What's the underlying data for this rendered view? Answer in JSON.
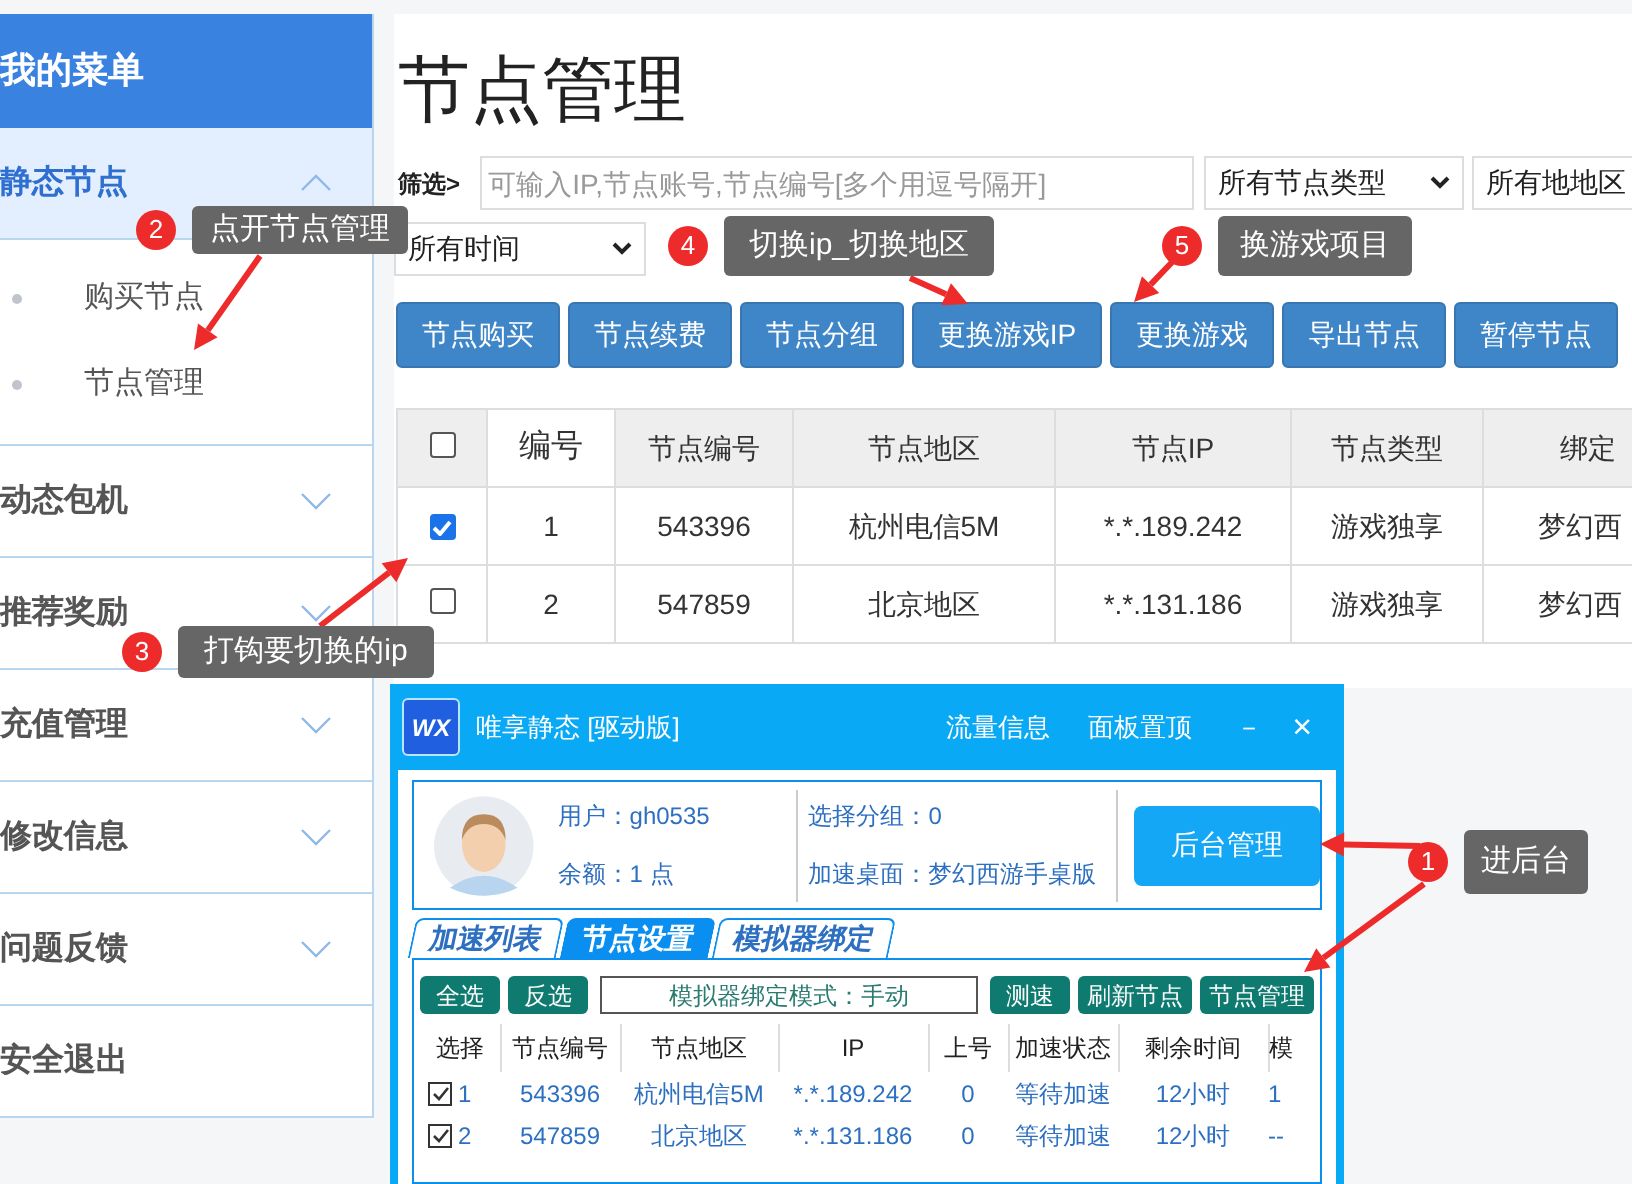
{
  "sidebar": {
    "title": "我的菜单",
    "items": [
      {
        "kind": "group",
        "label": "静态节点",
        "expanded": true,
        "children": [
          {
            "label": "购买节点"
          },
          {
            "label": "节点管理"
          }
        ]
      },
      {
        "kind": "group",
        "label": "动态包机",
        "expanded": false
      },
      {
        "kind": "group",
        "label": "推荐奖励",
        "expanded": false
      },
      {
        "kind": "group",
        "label": "充值管理",
        "expanded": false
      },
      {
        "kind": "group",
        "label": "修改信息",
        "expanded": false
      },
      {
        "kind": "group",
        "label": "问题反馈",
        "expanded": false
      },
      {
        "kind": "link",
        "label": "安全退出"
      }
    ]
  },
  "main": {
    "title": "节点管理",
    "filter_label": "筛选>",
    "search": {
      "placeholder": "可输入IP,节点账号,节点编号[多个用逗号隔开]"
    },
    "selects": [
      "所有节点类型",
      "所有地地区",
      "所有时间"
    ],
    "buttons": [
      "节点购买",
      "节点续费",
      "节点分组",
      "更换游戏IP",
      "更换游戏",
      "导出节点",
      "暂停节点"
    ],
    "table": {
      "select_all_checked": false,
      "columns": [
        "编号",
        "节点编号",
        "节点地区",
        "节点IP",
        "节点类型",
        "绑定"
      ],
      "rows": [
        {
          "checked": true,
          "cells": [
            "1",
            "543396",
            "杭州电信5M",
            "*.*.189.242",
            "游戏独享",
            "梦幻西"
          ]
        },
        {
          "checked": false,
          "cells": [
            "2",
            "547859",
            "北京地区",
            "*.*.131.186",
            "游戏独享",
            "梦幻西"
          ]
        }
      ]
    }
  },
  "app": {
    "logo_text": "WX",
    "title": "唯享静态 [驱动版]",
    "menu": [
      "流量信息",
      "面板置顶"
    ],
    "minimize": "－",
    "close": "×",
    "info": {
      "user": "用户：gh0535",
      "balance": "余额：1 点",
      "group": "选择分组：0",
      "desktop": "加速桌面：梦幻西游手桌版"
    },
    "admin_button": "后台管理",
    "tabs": [
      {
        "label": "加速列表",
        "selected": false
      },
      {
        "label": "节点设置",
        "selected": true
      },
      {
        "label": "模拟器绑定",
        "selected": false
      }
    ],
    "toolbar": [
      {
        "kind": "button",
        "label": "全选"
      },
      {
        "kind": "button",
        "label": "反选"
      },
      {
        "kind": "field",
        "label": "模拟器绑定模式：手动"
      },
      {
        "kind": "button",
        "label": "测速"
      },
      {
        "kind": "button",
        "label": "刷新节点"
      },
      {
        "kind": "button",
        "label": "节点管理"
      }
    ],
    "table": {
      "columns": [
        "选择",
        "节点编号",
        "节点地区",
        "IP",
        "上号",
        "加速状态",
        "剩余时间",
        "模"
      ],
      "rows": [
        {
          "checked": true,
          "cells": [
            "1",
            "543396",
            "杭州电信5M",
            "*.*.189.242",
            "0",
            "等待加速",
            "12小时",
            "1"
          ]
        },
        {
          "checked": true,
          "cells": [
            "2",
            "547859",
            "北京地区",
            "*.*.131.186",
            "0",
            "等待加速",
            "12小时",
            "--"
          ]
        }
      ]
    }
  },
  "annotations": [
    {
      "number": "1",
      "text": "进后台"
    },
    {
      "number": "2",
      "text": "点开节点管理"
    },
    {
      "number": "3",
      "text": "打钩要切换的ip"
    },
    {
      "number": "4",
      "text": "切换ip_切换地区"
    },
    {
      "number": "5",
      "text": "换游戏项目"
    }
  ]
}
